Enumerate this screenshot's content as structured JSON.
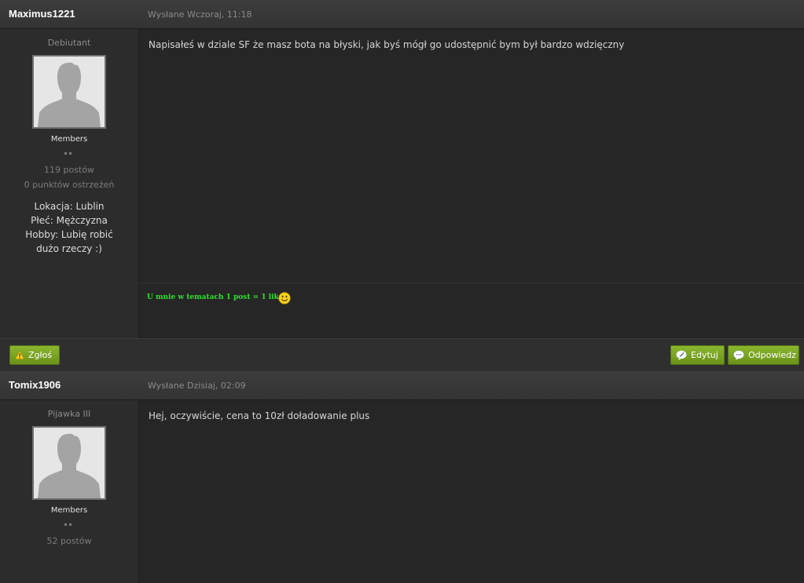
{
  "posts": [
    {
      "author": "Maximus1221",
      "posted": "Wysłane Wczoraj, 11:18",
      "rank": "Debiutant",
      "group": "Members",
      "post_count": "119 postów",
      "warn_points": "0 punktów ostrzeżeń",
      "profile_fields": [
        "Lokacja: Lublin",
        "Płeć: Mężczyzna",
        "Hobby: Lubię robić dużo rzeczy :)"
      ],
      "body": "Napisałeś w dziale SF że masz bota na błyski, jak byś mógł go udostępnić bym był bardzo wdzięczny",
      "signature": "U mnie w tematach 1 post = 1 like",
      "signature_color": "#2ee02e"
    },
    {
      "author": "Tomix1906",
      "posted": "Wysłane Dzisiaj, 02:09",
      "rank": "Pijawka III",
      "group": "Members",
      "post_count": "52 postów",
      "body": "Hej, oczywiście, cena to 10zł doładowanie plus"
    }
  ],
  "buttons": {
    "report": "Zgłoś",
    "edit": "Edytuj",
    "reply": "Odpowiedz"
  },
  "icons": {
    "report": "warning-icon",
    "edit": "edit-icon",
    "reply": "speech-bubble-icon",
    "smiley": "smiley-icon"
  },
  "colors": {
    "button_green": "#7aa423",
    "background": "#262626"
  }
}
